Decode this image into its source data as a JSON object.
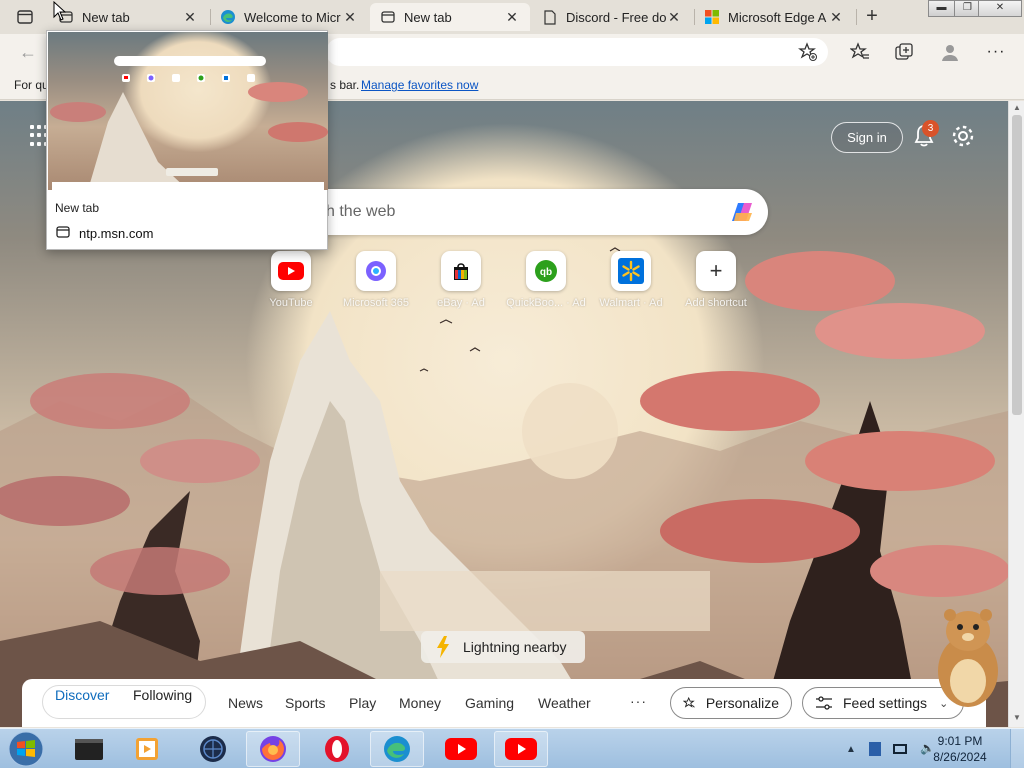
{
  "browser": {
    "tabs": [
      {
        "title": "New tab",
        "icon": "ntp-icon",
        "active": false
      },
      {
        "title": "Welcome to Micr",
        "icon": "edge-icon",
        "active": false
      },
      {
        "title": "New tab",
        "icon": "ntp-icon",
        "active": true
      },
      {
        "title": "Discord - Free do",
        "icon": "page-icon",
        "active": false
      },
      {
        "title": "Microsoft Edge A",
        "icon": "microsoft-icon",
        "active": false
      }
    ],
    "favorites_bar": {
      "prefix": "For qu",
      "suffix": "s bar.",
      "link": "Manage favorites now"
    }
  },
  "tab_preview": {
    "title": "New tab",
    "url": "ntp.msn.com"
  },
  "ntp": {
    "sign_in": "Sign in",
    "notification_count": "3",
    "search_placeholder": "ch the web",
    "shortcuts": [
      {
        "label": "YouTube",
        "icon": "youtube-icon"
      },
      {
        "label": "Microsoft 365",
        "icon": "m365-icon"
      },
      {
        "label": "eBay · Ad",
        "icon": "ebay-icon"
      },
      {
        "label": "QuickBoo... · Ad",
        "icon": "quickbooks-icon"
      },
      {
        "label": "Walmart · Ad",
        "icon": "walmart-icon"
      },
      {
        "label": "Add shortcut",
        "icon": "plus-icon"
      }
    ],
    "weather_alert": "Lightning nearby",
    "feed": {
      "tabs": [
        "Discover",
        "Following"
      ],
      "selected_tab": "Discover",
      "links": [
        "News",
        "Sports",
        "Play",
        "Money",
        "Gaming",
        "Weather"
      ],
      "more": "···",
      "personalize": "Personalize",
      "feed_settings": "Feed settings"
    }
  },
  "taskbar": {
    "time": "9:01 PM",
    "date": "8/26/2024"
  },
  "colors": {
    "accent": "#0f6cbd",
    "badge": "#d9532a",
    "tab_strip": "#e4e0d8"
  }
}
